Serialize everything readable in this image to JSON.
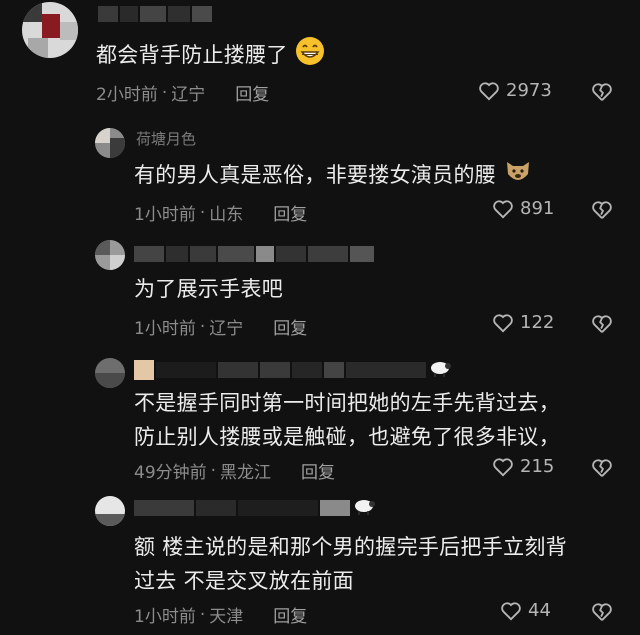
{
  "comments": [
    {
      "content": "都会背手防止搂腰了",
      "emoji": "grinning-face",
      "time": "2小时前",
      "location": "辽宁",
      "reply_label": "回复",
      "likes": "2973"
    },
    {
      "username": "荷塘月色",
      "content": "有的男人真是恶俗，非要搂女演员的腰",
      "emoji": "dog-face",
      "time": "1小时前",
      "location": "山东",
      "reply_label": "回复",
      "likes": "891"
    },
    {
      "content": "为了展示手表吧",
      "time": "1小时前",
      "location": "辽宁",
      "reply_label": "回复",
      "likes": "122"
    },
    {
      "content_line1": "不是握手同时第一时间把她的左手先背过去，",
      "content_line2": "防止别人搂腰或是触碰，也避免了很多非议，",
      "time": "49分钟前",
      "location": "黑龙江",
      "reply_label": "回复",
      "likes": "215"
    },
    {
      "content_line1": "额 楼主说的是和那个男的握完手后把手立刻背",
      "content_line2": "过去 不是交叉放在前面",
      "time": "1小时前",
      "location": "天津",
      "reply_label": "回复",
      "likes": "44"
    }
  ],
  "separator": "·",
  "colors": {
    "background": "#111111",
    "text": "#ececec",
    "meta": "#8c8c8c"
  }
}
